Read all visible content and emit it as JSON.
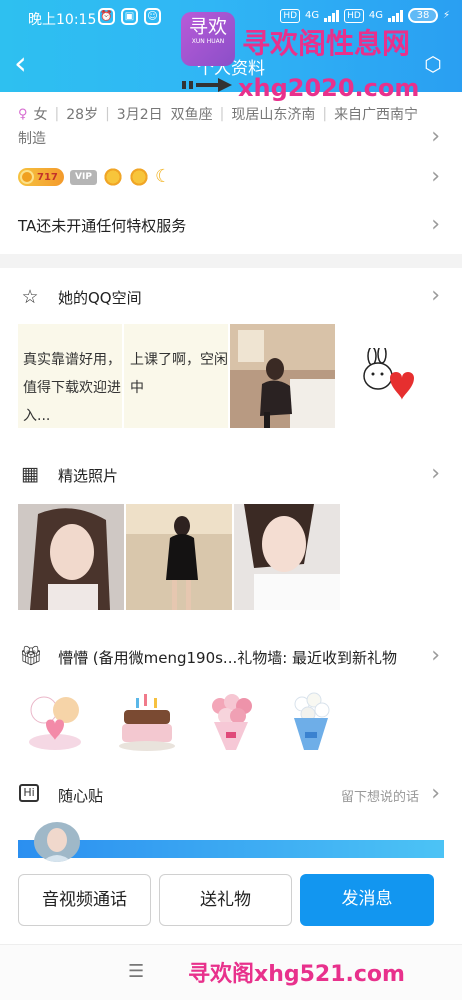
{
  "status_bar": {
    "time": "晚上10:15",
    "hd1": "HD",
    "net1": "4G",
    "hd2": "HD",
    "net2": "4G",
    "battery": "38"
  },
  "header": {
    "title": "个人资料",
    "back_icon": "chevron-left-icon",
    "share_icon": "share-icon"
  },
  "watermark": {
    "logo_text": "寻欢",
    "logo_sub": "XUN HUAN",
    "site_name": "寻欢阁性息网",
    "url": "xhg2020.com",
    "bottom": "寻欢阁xhg521.com"
  },
  "profile": {
    "gender": "女",
    "age": "28岁",
    "birthday": "3月2日",
    "zodiac": "双鱼座",
    "location": "现居山东济南",
    "hometown": "来自广西南宁",
    "job": "制造",
    "level_number": "717",
    "vip_label": "VIP",
    "privilege_text": "TA还未开通任何特权服务"
  },
  "qq_zone": {
    "title": "她的QQ空间",
    "posts": [
      {
        "text": "真实靠谱好用，值得下载欢迎进入..."
      },
      {
        "text": "上课了啊，空闲中"
      }
    ]
  },
  "photos": {
    "title": "精选照片"
  },
  "gifts": {
    "title": "懵懵 (备用微meng190s...礼物墙: 最近收到新礼物",
    "items": [
      "bear-gift",
      "cake-gift",
      "flower-bouquet-gift",
      "blue-bouquet-gift"
    ]
  },
  "note": {
    "title": "随心贴",
    "action": "留下想说的话"
  },
  "buttons": {
    "call": "音视频通话",
    "gift": "送礼物",
    "message": "发消息"
  },
  "colors": {
    "header_start": "#2ec0f0",
    "header_end": "#2a9ff2",
    "primary": "#1296f0",
    "watermark": "#e8318c"
  }
}
